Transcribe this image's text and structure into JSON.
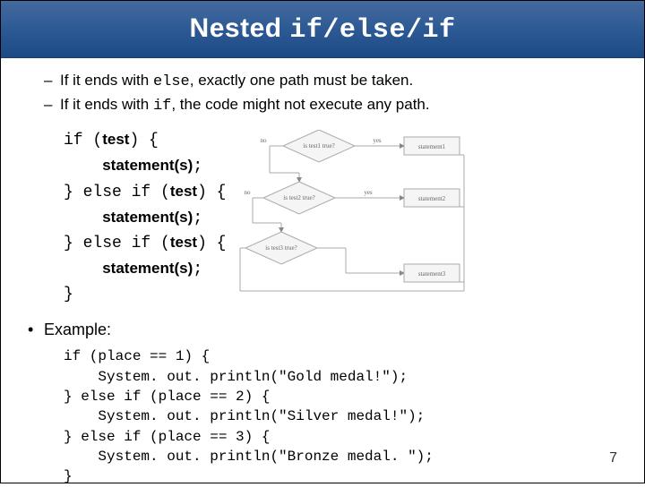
{
  "header": {
    "title_plain": "Nested ",
    "title_mono": "if/else/if"
  },
  "bullets": [
    {
      "pre": "If it ends with ",
      "code": "else",
      "post": ", exactly one path must be taken."
    },
    {
      "pre": "If it ends with ",
      "code": "if",
      "post": ", the code might not execute any path."
    }
  ],
  "syntax": {
    "l1a": "if (",
    "l1b": "test",
    "l1c": ") {",
    "l2": "statement(s)",
    "l2s": ";",
    "l3a": "} else if (",
    "l3b": "test",
    "l3c": ") {",
    "l4": "statement(s)",
    "l4s": ";",
    "l5a": "} else if (",
    "l5b": "test",
    "l5c": ") {",
    "l6": "statement(s)",
    "l6s": ";",
    "l7": "}"
  },
  "example_label": "Example:",
  "example": {
    "l1": "if (place == 1) {",
    "l2": "    System. out. println(\"Gold medal!\");",
    "l3": "} else if (place == 2) {",
    "l4": "    System. out. println(\"Silver medal!\");",
    "l5": "} else if (place == 3) {",
    "l6": "    System. out. println(\"Bronze medal. \");",
    "l7": "}"
  },
  "flowchart": {
    "labels": {
      "t1": "is test1 true?",
      "t2": "is test2 true?",
      "t3": "is test3 true?",
      "s1": "statement1",
      "s2": "statement2",
      "s3": "statement3",
      "yes": "yes",
      "no": "no"
    }
  },
  "page_number": "7"
}
